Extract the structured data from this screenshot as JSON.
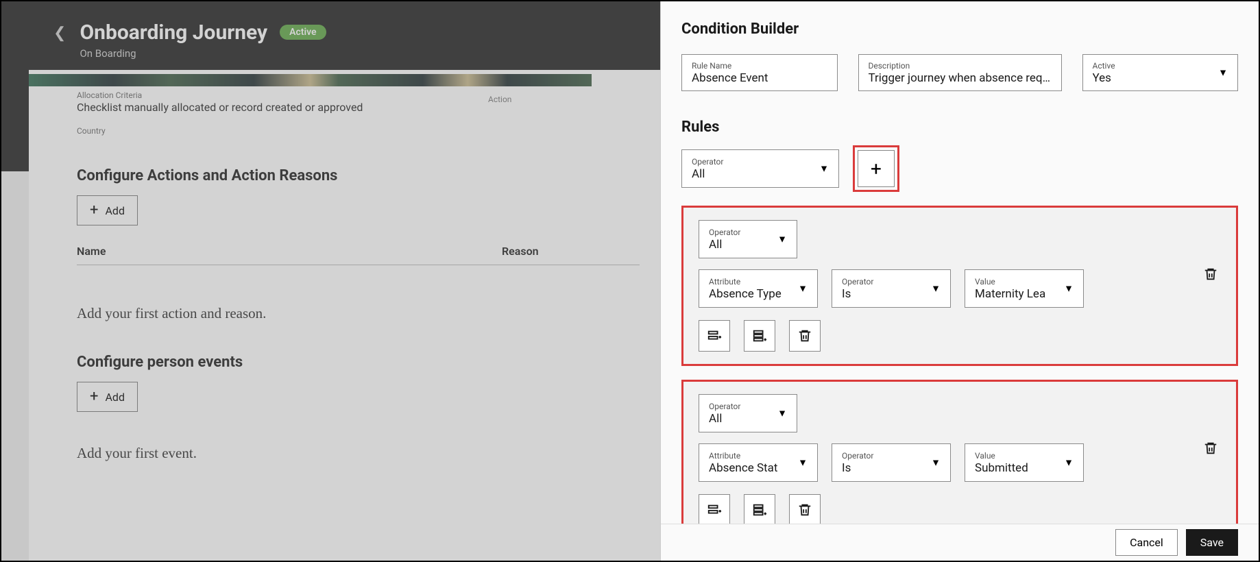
{
  "header": {
    "title": "Onboarding Journey",
    "status": "Active",
    "subtitle": "On Boarding"
  },
  "left": {
    "alloc_label": "Allocation Criteria",
    "alloc_value": "Checklist manually allocated or record created or approved",
    "action_label": "Action",
    "country_label": "Country",
    "section_actions": "Configure Actions and Action Reasons",
    "add_label": "Add",
    "col_name": "Name",
    "col_reason": "Reason",
    "placeholder_actions": "Add your first action and reason.",
    "section_events": "Configure person events",
    "placeholder_events": "Add your first event."
  },
  "cb": {
    "title": "Condition Builder",
    "rule_name_label": "Rule Name",
    "rule_name_value": "Absence Event",
    "desc_label": "Description",
    "desc_value": "Trigger journey when absence reque",
    "active_label": "Active",
    "active_value": "Yes",
    "rules_label": "Rules",
    "operator_label": "Operator",
    "operator_value": "All",
    "groups": [
      {
        "operator": "All",
        "attribute_label": "Attribute",
        "attribute_value": "Absence Type",
        "op_label": "Operator",
        "op_value": "Is",
        "value_label": "Value",
        "value_value": "Maternity Lea"
      },
      {
        "operator": "All",
        "attribute_label": "Attribute",
        "attribute_value": "Absence Stat",
        "op_label": "Operator",
        "op_value": "Is",
        "value_label": "Value",
        "value_value": "Submitted"
      }
    ],
    "cancel": "Cancel",
    "save": "Save"
  }
}
